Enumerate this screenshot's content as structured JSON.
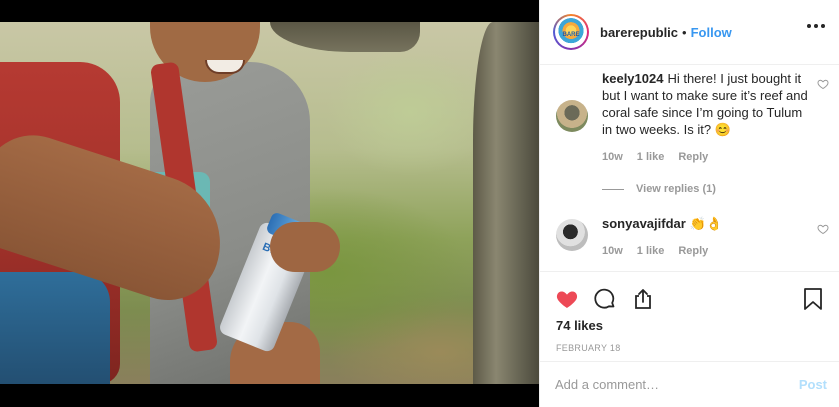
{
  "post": {
    "image_alt": "",
    "can_brand_text": "BARE"
  },
  "header": {
    "username": "barerepublic",
    "separator": "•",
    "follow_label": "Follow",
    "brand_logo_text": "BARE"
  },
  "comments": [
    {
      "username": "keely1024",
      "text": "Hi there! I just bought it but I want to make sure it’s reef and coral safe since I’m going to Tulum in two weeks. Is it? 😊",
      "age": "10w",
      "likes": "1 like",
      "reply_label": "Reply",
      "view_replies": "View replies (1)"
    },
    {
      "username": "sonyavajifdar",
      "text": "👏👌",
      "age": "10w",
      "likes": "1 like",
      "reply_label": "Reply"
    }
  ],
  "engagement": {
    "likes_text": "74 likes",
    "date": "February 18",
    "liked": true
  },
  "add_comment": {
    "placeholder": "Add a comment…",
    "post_label": "Post"
  },
  "colors": {
    "accent": "#3897f0",
    "heart": "#ed4956",
    "muted": "#999999",
    "post_disabled": "#b2dffc"
  },
  "icons": [
    "more-options-icon",
    "heart-icon",
    "comment-icon",
    "share-icon",
    "bookmark-icon"
  ]
}
